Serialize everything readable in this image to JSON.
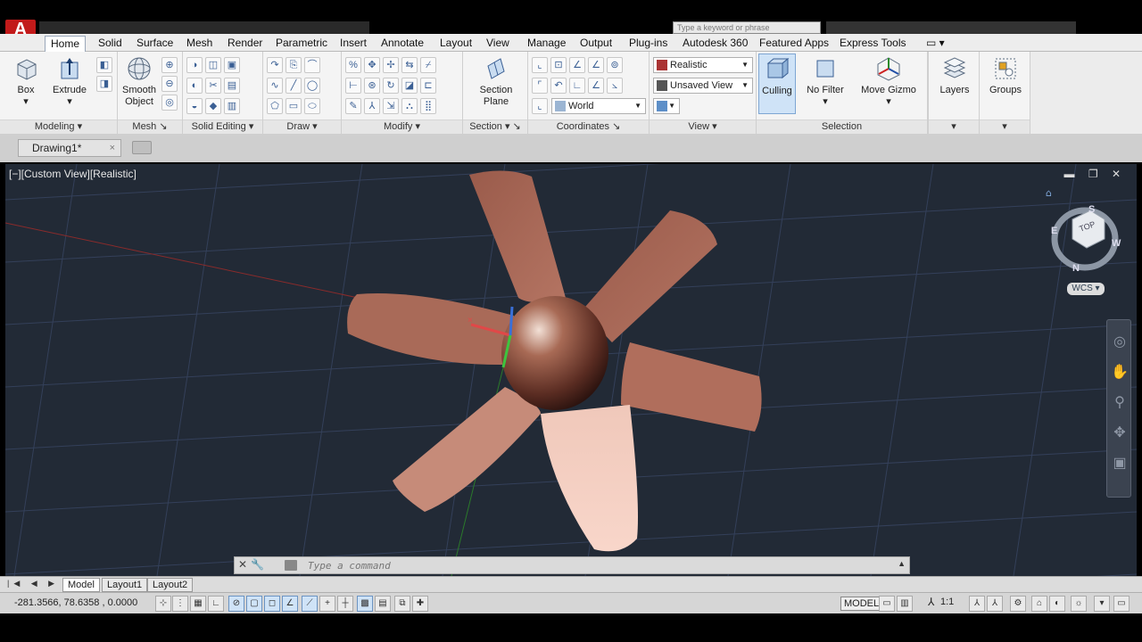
{
  "window": {
    "app_icon": "A",
    "search_placeholder": "Type a keyword or phrase"
  },
  "ribbon_tabs": [
    {
      "label": "Home",
      "active": true
    },
    {
      "label": "Solid"
    },
    {
      "label": "Surface"
    },
    {
      "label": "Mesh"
    },
    {
      "label": "Render"
    },
    {
      "label": "Parametric"
    },
    {
      "label": "Insert"
    },
    {
      "label": "Annotate"
    },
    {
      "label": "Layout"
    },
    {
      "label": "View"
    },
    {
      "label": "Manage"
    },
    {
      "label": "Output"
    },
    {
      "label": "Plug-ins"
    },
    {
      "label": "Autodesk 360"
    },
    {
      "label": "Featured Apps"
    },
    {
      "label": "Express Tools"
    }
  ],
  "panels": {
    "modeling": {
      "title": "Modeling",
      "box": "Box",
      "extrude": "Extrude"
    },
    "mesh": {
      "title": "Mesh",
      "smooth_object": "Smooth Object"
    },
    "solid_editing": {
      "title": "Solid Editing"
    },
    "draw": {
      "title": "Draw"
    },
    "modify": {
      "title": "Modify"
    },
    "section": {
      "title": "Section",
      "section_plane": "Section Plane"
    },
    "coordinates": {
      "title": "Coordinates",
      "ucs": "World"
    },
    "view": {
      "title": "View",
      "visual_style": "Realistic",
      "named_view": "Unsaved View"
    },
    "selection": {
      "title": "Selection",
      "culling": "Culling",
      "no_filter": "No Filter",
      "move_gizmo": "Move Gizmo"
    },
    "layers": {
      "label": "Layers"
    },
    "groups": {
      "label": "Groups"
    }
  },
  "file_tab": {
    "name": "Drawing1*",
    "close": "×"
  },
  "viewport": {
    "label": "[−][Custom View][Realistic]",
    "controls": "▬ ❐ ✕",
    "viewcube_face": "TOP",
    "compass": {
      "n": "N",
      "s": "S",
      "e": "E",
      "w": "W"
    },
    "wcs": "WCS ▾"
  },
  "command_line": {
    "placeholder": "Type a command",
    "close": "✕",
    "settings": "🔧"
  },
  "layout_tabs": [
    {
      "label": "Model",
      "active": true
    },
    {
      "label": "Layout1"
    },
    {
      "label": "Layout2"
    }
  ],
  "status": {
    "coordinates": "-281.3566, 78.6358 , 0.0000",
    "space": "MODEL",
    "annotation_scale": "1:1"
  },
  "colors": {
    "viewport_bg": "#222a36",
    "blade": "#b8705c",
    "accent": "#3a5f94"
  }
}
